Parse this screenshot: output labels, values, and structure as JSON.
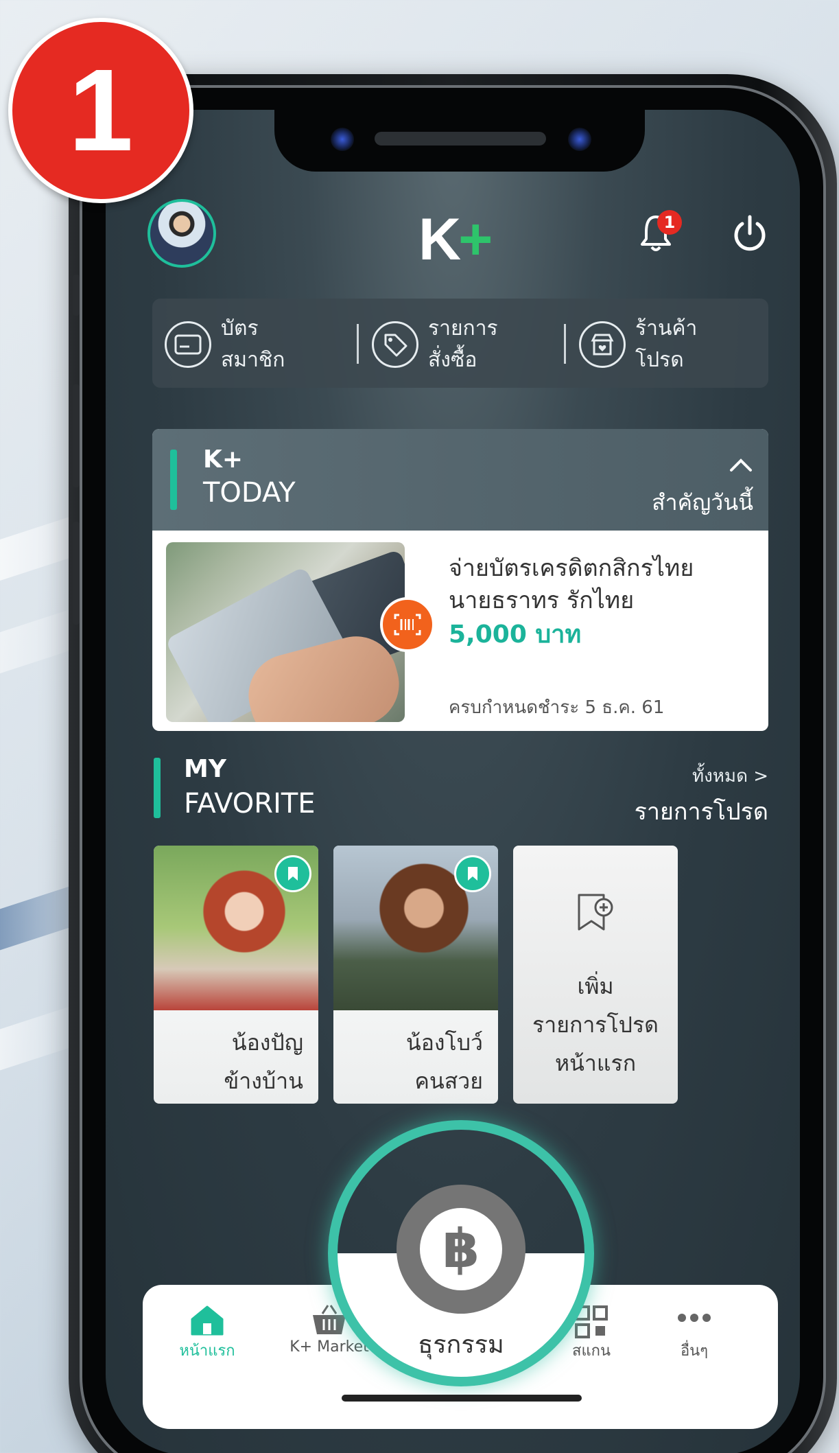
{
  "step_badge": "1",
  "header": {
    "logo_k": "K",
    "logo_plus": "+",
    "notification_count": "1"
  },
  "quick_menu": [
    {
      "line1": "บัตร",
      "line2": "สมาชิก",
      "icon": "member-card-icon"
    },
    {
      "line1": "รายการ",
      "line2": "สั่งซื้อ",
      "icon": "price-tag-icon"
    },
    {
      "line1": "ร้านค้า",
      "line2": "โปรด",
      "icon": "favorite-shop-icon"
    }
  ],
  "today": {
    "title1": "K+",
    "title2": "TODAY",
    "subtitle": "สำคัญวันนี้",
    "item_title1": "จ่ายบัตรเครดิตกสิกรไทย",
    "item_title2": "นายธราทร รักไทย",
    "amount": "5,000 บาท",
    "due": "ครบกำหนดชำระ 5 ธ.ค. 61"
  },
  "favorite": {
    "title1": "MY",
    "title2": "FAVORITE",
    "see_all": "ทั้งหมด >",
    "list_label": "รายการโปรด",
    "items": [
      {
        "line1": "น้องปัญ",
        "line2": "ข้างบ้าน"
      },
      {
        "line1": "น้องโบว์",
        "line2": "คนสวย"
      }
    ],
    "add": {
      "line1": "เพิ่ม",
      "line2": "รายการโปรด",
      "line3": "หน้าแรก"
    }
  },
  "tabbar": {
    "home": "หน้าแรก",
    "market": "K+ Market",
    "transaction": "ธุรกรรม",
    "scan": "สแกน",
    "more": "อื่นๆ",
    "currency_symbol": "฿"
  },
  "colors": {
    "accent": "#1fbf9b",
    "badge_red": "#e52a22",
    "amount_green": "#1bb39a",
    "scan_orange": "#f2621c"
  }
}
